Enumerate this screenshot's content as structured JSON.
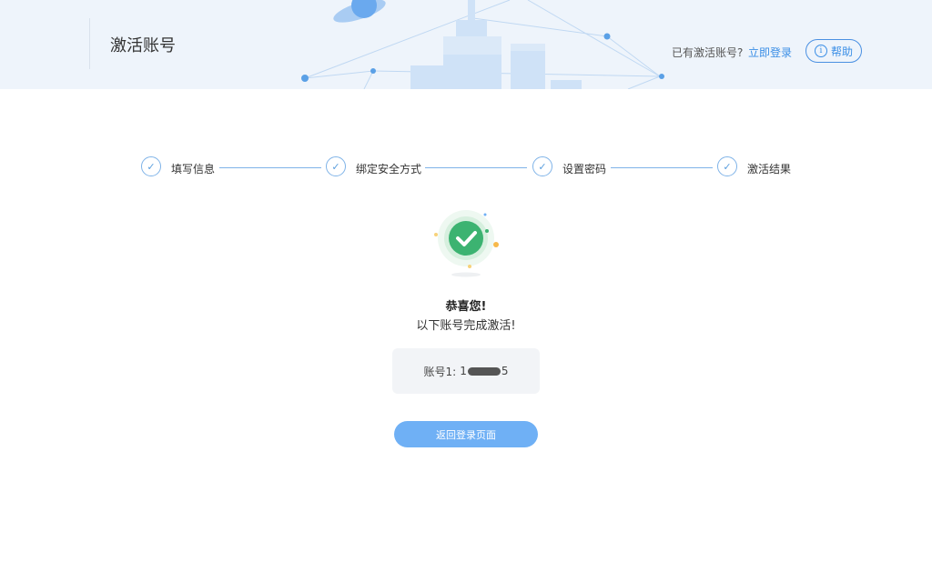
{
  "header": {
    "title": "激活账号",
    "login_prompt": "已有激活账号?",
    "login_link": "立即登录",
    "help_label": "帮助",
    "help_icon": "info-icon"
  },
  "steps": [
    {
      "label": "填写信息",
      "status": "done"
    },
    {
      "label": "绑定安全方式",
      "status": "done"
    },
    {
      "label": "设置密码",
      "status": "done"
    },
    {
      "label": "激活结果",
      "status": "done"
    }
  ],
  "result": {
    "title": "恭喜您!",
    "subtitle": "以下账号完成激活!",
    "account_label": "账号1:",
    "account_prefix": "1",
    "account_suffix": "5",
    "button_label": "返回登录页面"
  },
  "colors": {
    "accent": "#3a8ee6",
    "success": "#3cb371",
    "button_bg": "#6fb0f5",
    "header_bg": "#eef4fb"
  }
}
